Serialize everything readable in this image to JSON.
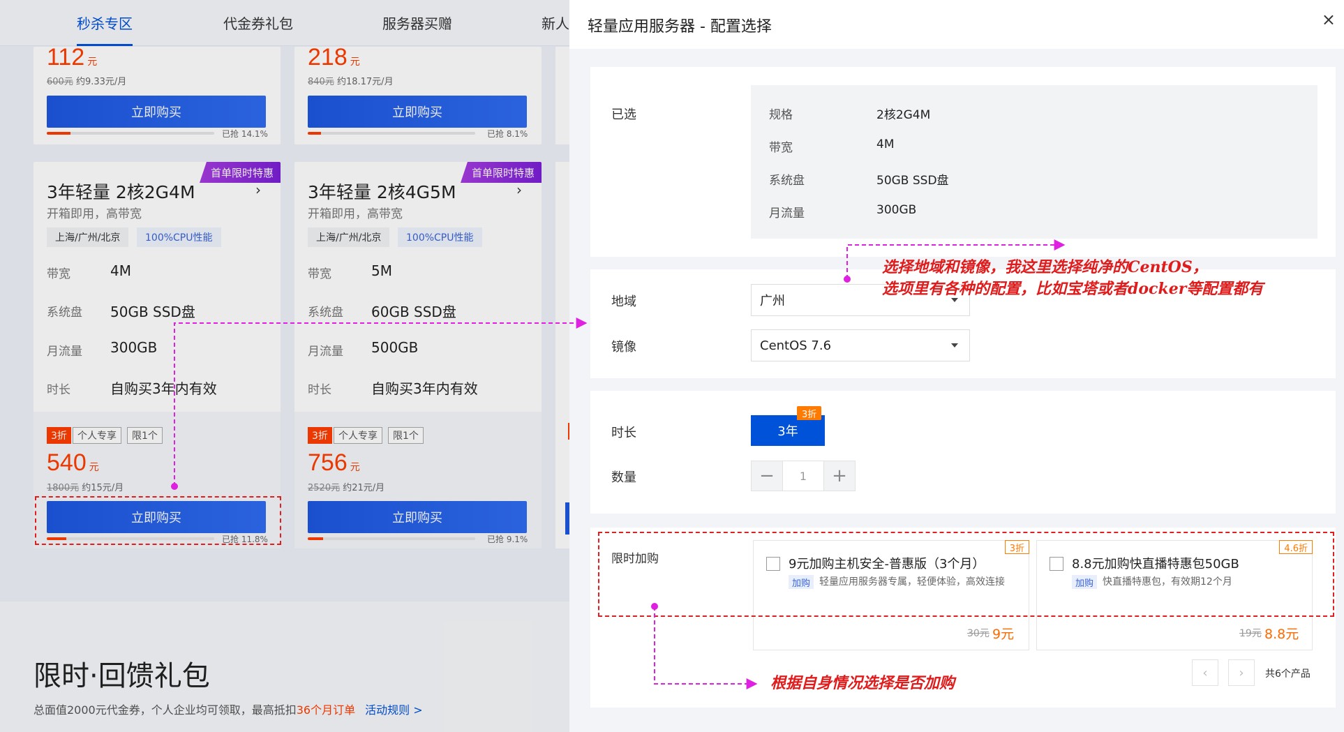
{
  "bg": {
    "tabs": [
      "秒杀专区",
      "代金券礼包",
      "服务器买赠",
      "新人"
    ],
    "top_cards": [
      {
        "price": "112",
        "unit": "元",
        "orig": "600元",
        "monthly": "约9.33元/月",
        "buy": "立即购买",
        "sold": "已抢 14.1%",
        "sold_pct": 0.141
      },
      {
        "price": "218",
        "unit": "元",
        "orig": "840元",
        "monthly": "约18.17元/月",
        "buy": "立即购买",
        "sold": "已抢 8.1%",
        "sold_pct": 0.081
      }
    ],
    "cards": [
      {
        "badge": "首单限时特惠",
        "title": "3年轻量 2核2G4M",
        "sub": "开箱即用，高带宽",
        "region": "上海/广州/北京",
        "cpu": "100%CPU性能",
        "specs": [
          {
            "k": "带宽",
            "v": "4M"
          },
          {
            "k": "系统盘",
            "v": "50GB SSD盘"
          },
          {
            "k": "月流量",
            "v": "300GB"
          },
          {
            "k": "时长",
            "v": "自购买3年内有效"
          }
        ],
        "tags": [
          "3折",
          "个人专享",
          "限1个"
        ],
        "price": "540",
        "unit": "元",
        "orig": "1800元",
        "monthly": "约15元/月",
        "buy": "立即购买",
        "sold": "已抢 11.8%",
        "sold_pct": 0.118
      },
      {
        "badge": "首单限时特惠",
        "title": "3年轻量 2核4G5M",
        "sub": "开箱即用，高带宽",
        "region": "上海/广州/北京",
        "cpu": "100%CPU性能",
        "specs": [
          {
            "k": "带宽",
            "v": "5M"
          },
          {
            "k": "系统盘",
            "v": "60GB SSD盘"
          },
          {
            "k": "月流量",
            "v": "500GB"
          },
          {
            "k": "时长",
            "v": "自购买3年内有效"
          }
        ],
        "tags": [
          "3折",
          "个人专享",
          "限1个"
        ],
        "price": "756",
        "unit": "元",
        "orig": "2520元",
        "monthly": "约21元/月",
        "buy": "立即购买",
        "sold": "已抢 9.1%",
        "sold_pct": 0.091
      }
    ],
    "gift": {
      "title": "限时·回馈礼包",
      "desc_a": "总面值2000元代金券，个人企业均可领取，最高抵扣",
      "desc_hl": "36个月订单",
      "link": "活动规则 >"
    }
  },
  "drawer": {
    "title": "轻量应用服务器 - 配置选择",
    "close": "×",
    "selected_label": "已选",
    "selected": [
      {
        "k": "规格",
        "v": "2核2G4M"
      },
      {
        "k": "带宽",
        "v": "4M"
      },
      {
        "k": "系统盘",
        "v": "50GB SSD盘"
      },
      {
        "k": "月流量",
        "v": "300GB"
      }
    ],
    "region_label": "地域",
    "region_value": "广州",
    "image_label": "镜像",
    "image_value": "CentOS 7.6",
    "duration_label": "时长",
    "duration_value": "3年",
    "duration_badge": "3折",
    "quantity_label": "数量",
    "quantity_value": "1",
    "addon_label": "限时加购",
    "addons": [
      {
        "discount": "3折",
        "title": "9元加购主机安全-普惠版（3个月）",
        "tag": "加购",
        "desc": "轻量应用服务器专属，轻便体验，高效连接",
        "old": "30元",
        "price": "9元"
      },
      {
        "discount": "4.6折",
        "title": "8.8元加购快直播特惠包50GB",
        "tag": "加购",
        "desc": "快直播特惠包，有效期12个月",
        "old": "19元",
        "price": "8.8元"
      }
    ],
    "pager_total": "共6个产品"
  },
  "notes": {
    "line1": "选择地域和镜像，我这里选择纯净的CentOS，",
    "line2": "选项里有各种的配置，比如宝塔或者docker等配置都有",
    "line3": "根据自身情况选择是否加购"
  },
  "colors": {
    "accent": "#0052d9",
    "price": "#ff3d00",
    "annotation": "#e01b1b",
    "arrow": "#e020e0"
  }
}
